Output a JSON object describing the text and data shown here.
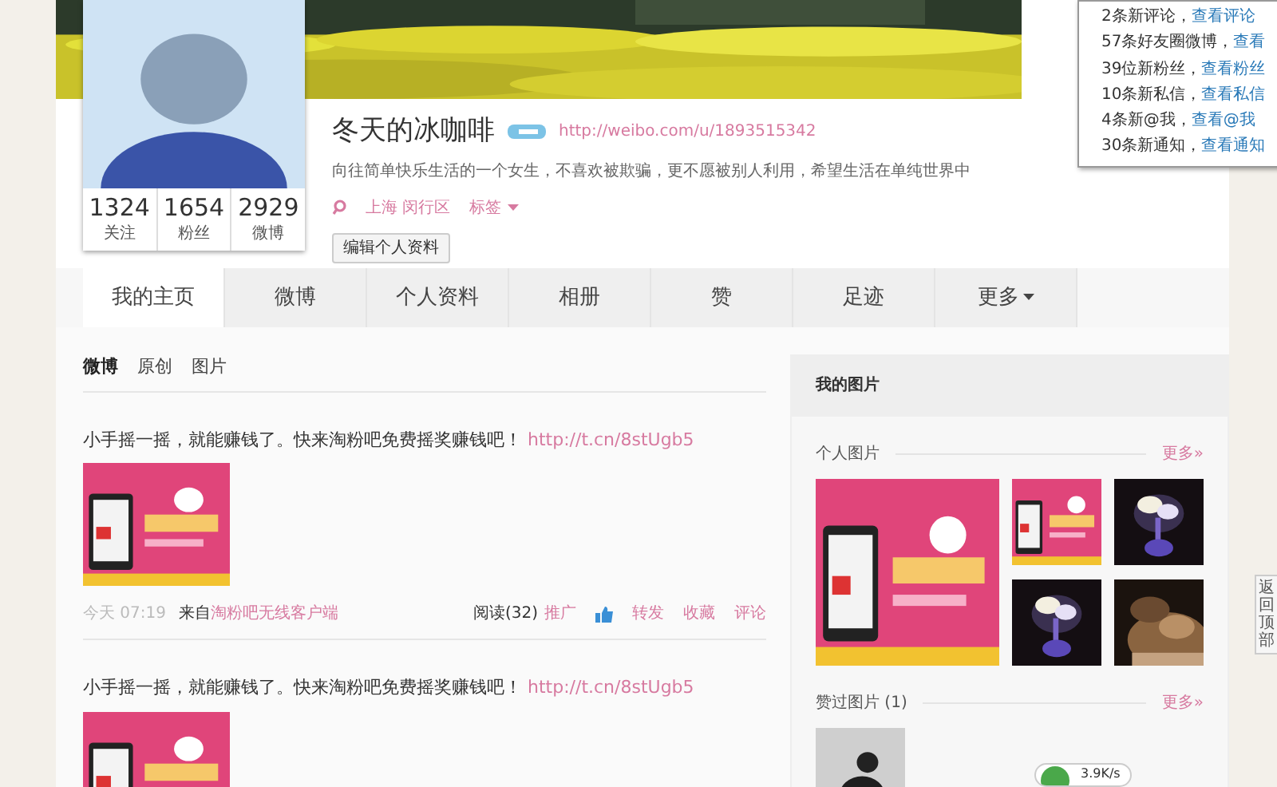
{
  "profile": {
    "name": "冬天的冰咖啡",
    "url": "http://weibo.com/u/1893515342",
    "bio": "向往简单快乐生活的一个女生，不喜欢被欺骗，更不愿被别人利用，希望生活在单纯世界中",
    "location": "上海 闵行区",
    "tags_label": "标签",
    "edit_button": "编辑个人资料"
  },
  "stats": [
    {
      "value": "1324",
      "label": "关注"
    },
    {
      "value": "1654",
      "label": "粉丝"
    },
    {
      "value": "2929",
      "label": "微博"
    }
  ],
  "notifications": [
    {
      "text": "2条新评论，",
      "link": "查看评论"
    },
    {
      "text": "57条好友圈微博，",
      "link": "查看"
    },
    {
      "text": "39位新粉丝，",
      "link": "查看粉丝"
    },
    {
      "text": "10条新私信，",
      "link": "查看私信"
    },
    {
      "text": "4条新@我，",
      "link": "查看@我"
    },
    {
      "text": "30条新通知，",
      "link": "查看通知"
    }
  ],
  "tabs": [
    {
      "label": "我的主页",
      "selected": true,
      "dropdown": false
    },
    {
      "label": "微博",
      "selected": false,
      "dropdown": false
    },
    {
      "label": "个人资料",
      "selected": false,
      "dropdown": false
    },
    {
      "label": "相册",
      "selected": false,
      "dropdown": false
    },
    {
      "label": "赞",
      "selected": false,
      "dropdown": false
    },
    {
      "label": "足迹",
      "selected": false,
      "dropdown": false
    },
    {
      "label": "更多",
      "selected": false,
      "dropdown": true
    }
  ],
  "feed_filters": [
    {
      "label": "微博",
      "selected": true
    },
    {
      "label": "原创",
      "selected": false
    },
    {
      "label": "图片",
      "selected": false
    }
  ],
  "posts": [
    {
      "text": "小手摇一摇，就能赚钱了。快来淘粉吧免费摇奖赚钱吧！",
      "link": "http://t.cn/8stUgb5",
      "time": "今天 07:19",
      "source_prefix": "来自",
      "source": "淘粉吧无线客户端",
      "reads": "阅读(32)",
      "promote": "推广",
      "actions": [
        "转发",
        "收藏",
        "评论"
      ]
    },
    {
      "text": "小手摇一摇，就能赚钱了。快来淘粉吧免费摇奖赚钱吧！",
      "link": "http://t.cn/8stUgb5"
    }
  ],
  "sidebar": {
    "title": "我的图片",
    "sections": [
      {
        "title": "个人图片",
        "more": "更多»"
      },
      {
        "title": "赞过图片",
        "count": "(1)",
        "more": "更多»"
      }
    ]
  },
  "back_to_top": {
    "label": "返回顶部"
  },
  "speed_widget": {
    "reading": "3.9K/s"
  }
}
